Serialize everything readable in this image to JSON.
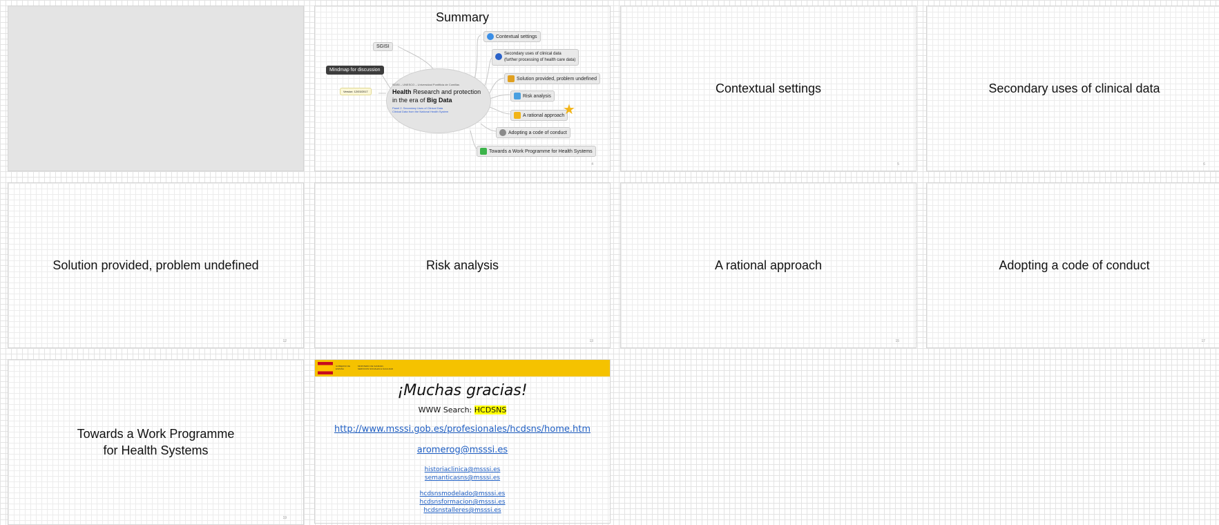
{
  "slides": [
    {
      "id": 1,
      "blank": true
    },
    {
      "id": 2,
      "title": "Summary",
      "mindmap": {
        "central": {
          "org": "SGISI – UNESCO – Universidad Pontificia de Comillas",
          "title_bold": "Health",
          "title_rest": " Research and protection",
          "title_line2_pre": "in the era of ",
          "title_line2_bold": "Big Data",
          "panel": "Panel 2. Secondary Uses of Clinical Data",
          "panel2": "Clinical Data from the National Health System"
        },
        "left_nodes": {
          "sgisi": "SGISI",
          "mindmap": "Mindmap for discussion",
          "version": "Version: 12/03/2017"
        },
        "right_nodes": [
          {
            "label": "Contextual settings",
            "icon": "info-icon",
            "color": "#3a8ee6"
          },
          {
            "label": "Secondary uses of clinical data",
            "label2": "(further processing of health care data)",
            "icon": "globe-icon",
            "color": "#2a62c9"
          },
          {
            "label": "Solution provided, problem undefined",
            "icon": "people-icon",
            "color": "#e0a020"
          },
          {
            "label": "Risk analysis",
            "icon": "chart-icon",
            "color": "#4aa0e0"
          },
          {
            "label": "A rational approach",
            "icon": "star-icon",
            "color": "#f2b418"
          },
          {
            "label": "Adopting a code of conduct",
            "icon": "gear-icon",
            "color": "#8a8a8a"
          },
          {
            "label": "Towards a Work Programme for Health Systems",
            "icon": "plus-icon",
            "color": "#3cb44a"
          }
        ]
      },
      "num": "4"
    },
    {
      "id": 3,
      "title": "Contextual settings",
      "num": "5"
    },
    {
      "id": 4,
      "title": "Secondary uses of clinical data",
      "num": "6"
    },
    {
      "id": 5,
      "title": "Solution provided, problem undefined",
      "num": "12"
    },
    {
      "id": 6,
      "title": "Risk analysis",
      "num": "13"
    },
    {
      "id": 7,
      "title": "A rational approach",
      "num": "15"
    },
    {
      "id": 8,
      "title": "Adopting a code of conduct",
      "num": "17"
    },
    {
      "id": 9,
      "title_line1": "Towards a Work Programme",
      "title_line2": "for Health Systems",
      "num": "19"
    },
    {
      "id": 10,
      "banner": {
        "gov": "GOBIERNO DE ESPAÑA",
        "ministry": "MINISTERIO DE SANIDAD, SERVICIOS SOCIALES E IGUALDAD",
        "color": "#f5c200"
      },
      "heading": "¡Muchas gracias!",
      "search_prefix": "WWW Search: ",
      "search_term": "HCDSNS",
      "url": "http://www.msssi.gob.es/profesionales/hcdsns/home.htm",
      "email_main": "aromerog@msssi.es",
      "emails_group1": [
        "historiaclinica@msssi.es",
        "semanticasns@msssi.es"
      ],
      "emails_group2": [
        "hcdsnsmodelado@msssi.es",
        "hcdsnsformacion@msssi.es",
        "hcdsnstalleres@msssi.es"
      ]
    }
  ]
}
